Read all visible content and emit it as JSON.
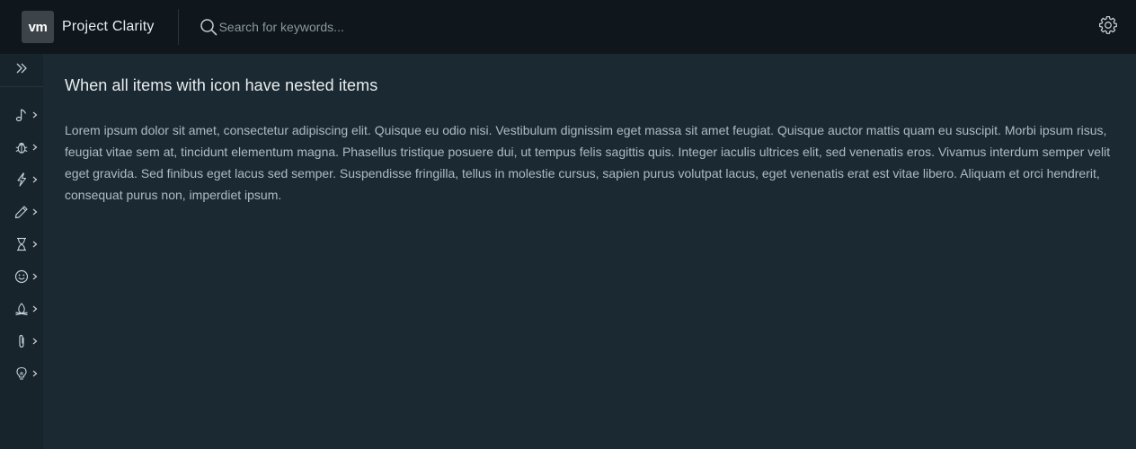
{
  "header": {
    "logo_text": "vm",
    "app_title": "Project Clarity",
    "search_placeholder": "Search for keywords...",
    "settings_icon": "gear-icon"
  },
  "sidebar": {
    "collapse_icon": "double-chevron-right-icon",
    "items": [
      {
        "icon": "music-note-icon"
      },
      {
        "icon": "bug-icon"
      },
      {
        "icon": "lightning-icon"
      },
      {
        "icon": "pencil-icon"
      },
      {
        "icon": "hourglass-icon"
      },
      {
        "icon": "happy-face-icon"
      },
      {
        "icon": "campfire-icon"
      },
      {
        "icon": "paperclip-icon"
      },
      {
        "icon": "lightbulb-icon"
      }
    ]
  },
  "main": {
    "title": "When all items with icon have nested items",
    "body": "Lorem ipsum dolor sit amet, consectetur adipiscing elit. Quisque eu odio nisi. Vestibulum dignissim eget massa sit amet feugiat. Quisque auctor mattis quam eu suscipit. Morbi ipsum risus, feugiat vitae sem at, tincidunt elementum magna. Phasellus tristique posuere dui, ut tempus felis sagittis quis. Integer iaculis ultrices elit, sed venenatis eros. Vivamus interdum semper velit eget gravida. Sed finibus eget lacus sed semper. Suspendisse fringilla, tellus in molestie cursus, sapien purus volutpat lacus, eget venenatis erat est vitae libero. Aliquam et orci hendrerit, consequat purus non, imperdiet ipsum."
  },
  "colors": {
    "header_bg": "#0f171c",
    "sidebar_bg": "#17242b",
    "content_bg": "#1b2a32",
    "text": "#adbbc4",
    "title_text": "#e9ecef"
  }
}
